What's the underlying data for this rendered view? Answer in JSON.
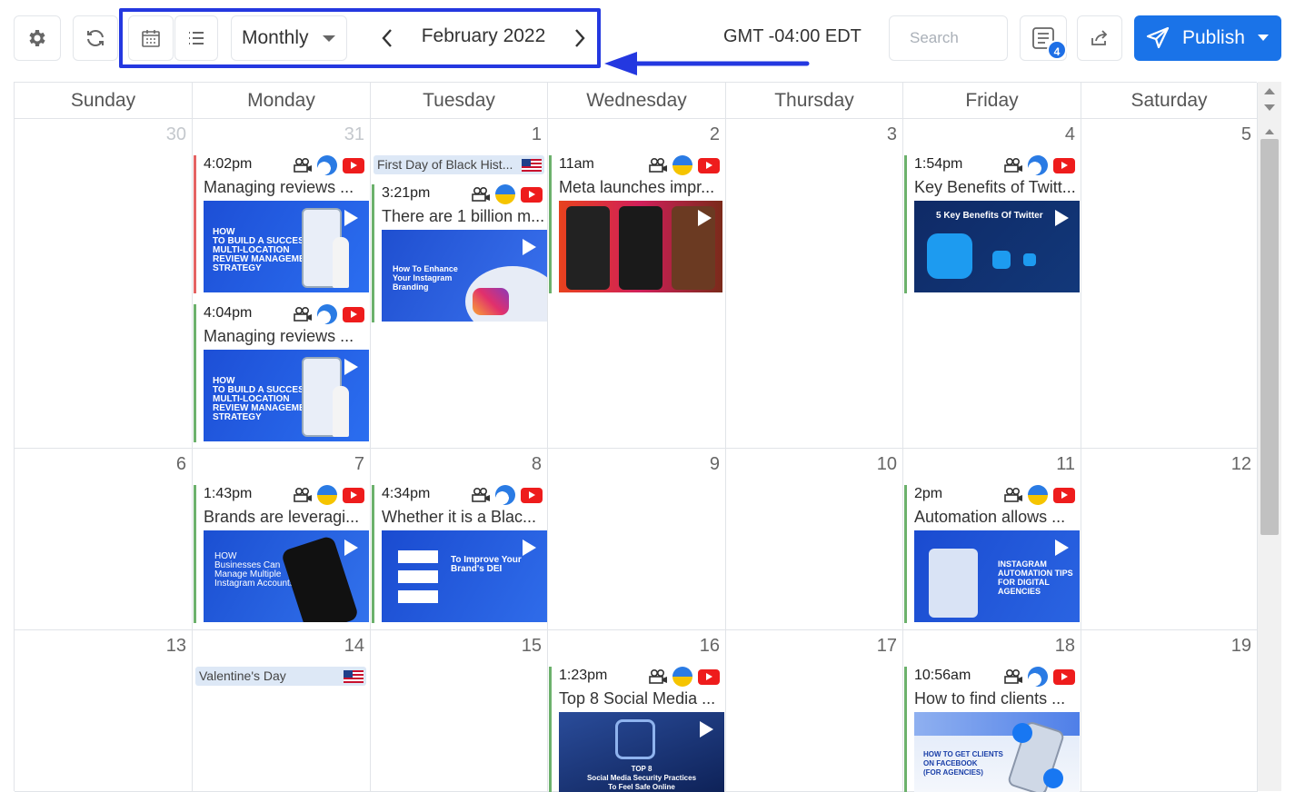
{
  "toolbar": {
    "view_select": "Monthly",
    "month_label": "February 2022",
    "timezone": "GMT -04:00 EDT",
    "search_placeholder": "Search",
    "filter_badge": "4",
    "publish_label": "Publish",
    "icons": [
      "gear-icon",
      "refresh-icon",
      "calendar-icon",
      "list-icon",
      "chevron-left-icon",
      "chevron-right-icon",
      "filter-icon",
      "share-icon",
      "send-icon",
      "chevron-down-icon"
    ]
  },
  "colors": {
    "accent": "#1a73e8",
    "highlight_border": "#2438e0",
    "post_border_green": "#6cb16c",
    "post_border_red": "#e56363"
  },
  "weekdays": [
    "Sunday",
    "Monday",
    "Tuesday",
    "Wednesday",
    "Thursday",
    "Friday",
    "Saturday"
  ],
  "days": {
    "w1": [
      "30",
      "31",
      "1",
      "2",
      "3",
      "4",
      "5"
    ],
    "w2": [
      "6",
      "7",
      "8",
      "9",
      "10",
      "11",
      "12"
    ],
    "w3": [
      "13",
      "14",
      "15",
      "16",
      "17",
      "18",
      "19"
    ]
  },
  "holidays": {
    "black_history": "First Day of Black Hist...",
    "valentine": "Valentine's Day"
  },
  "posts": {
    "mon31_a": {
      "time": "4:02pm",
      "title": "Managing reviews ...",
      "thumb": "HOW\nTO BUILD A SUCCESSFUL\nMULTI-LOCATION\nREVIEW MANAGEMENT\nSTRATEGY"
    },
    "mon31_b": {
      "time": "4:04pm",
      "title": "Managing reviews ...",
      "thumb": "HOW\nTO BUILD A SUCCESSFUL\nMULTI-LOCATION\nREVIEW MANAGEMENT\nSTRATEGY"
    },
    "tue1": {
      "time": "3:21pm",
      "title": "There are 1 billion m...",
      "thumb": "How To Enhance\nYour Instagram\nBranding"
    },
    "wed2": {
      "time": "11am",
      "title": "Meta launches impr..."
    },
    "fri4": {
      "time": "1:54pm",
      "title": "Key Benefits of Twitt...",
      "thumb": "5 Key Benefits Of Twitter"
    },
    "mon7": {
      "time": "1:43pm",
      "title": "Brands are leveragi...",
      "thumb": "HOW\nBusinesses Can\nManage Multiple\nInstagram Accounts"
    },
    "tue8": {
      "time": "4:34pm",
      "title": "Whether it is a Blac...",
      "thumb": "To Improve Your\nBrand's DEI"
    },
    "fri11": {
      "time": "2pm",
      "title": "Automation allows ...",
      "thumb": "INSTAGRAM\nAUTOMATION TIPS\nFOR DIGITAL\nAGENCIES"
    },
    "wed16": {
      "time": "1:23pm",
      "title": "Top 8 Social Media ...",
      "thumb": "TOP 8\nSocial Media Security Practices\nTo Feel Safe Online"
    },
    "fri18": {
      "time": "10:56am",
      "title": "How to find clients ...",
      "thumb": "HOW TO GET CLIENTS\nON FACEBOOK\n(FOR AGENCIES)"
    }
  }
}
